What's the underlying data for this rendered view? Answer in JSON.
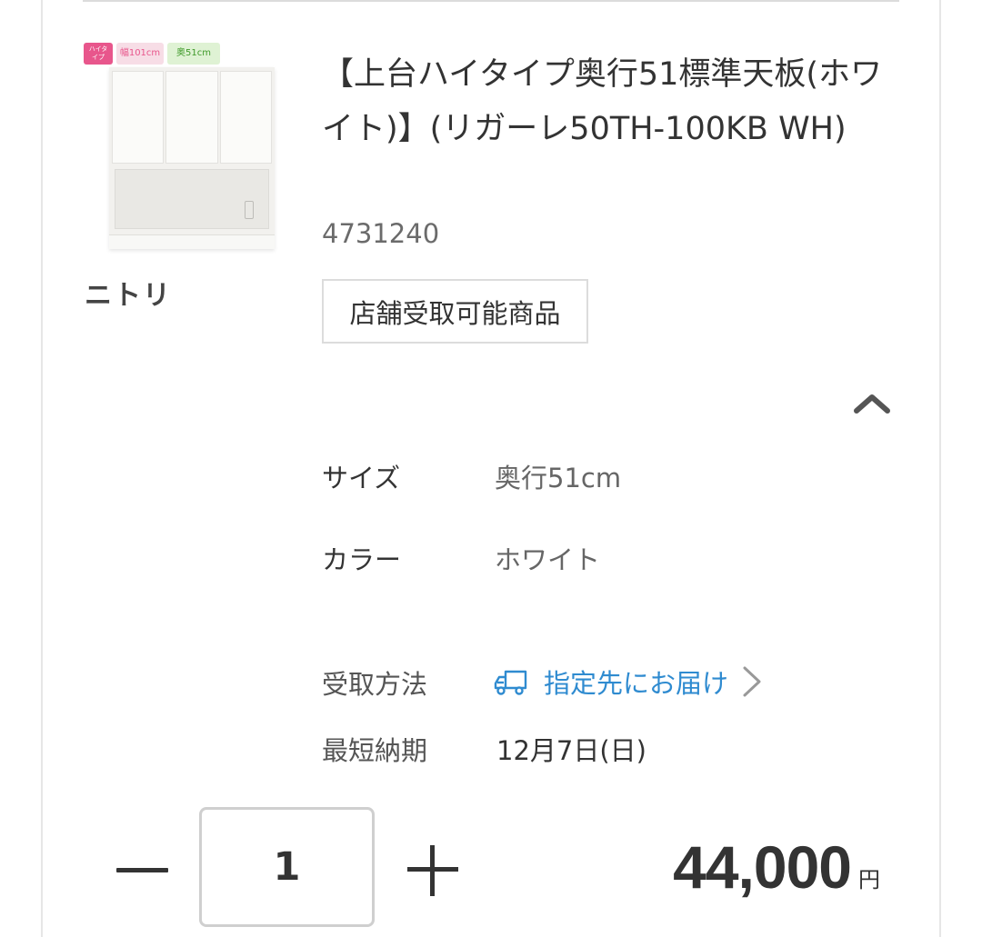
{
  "product": {
    "title": "【上台ハイタイプ奥行51標準天板(ホワイト)】(リガーレ50TH-100KB WH)",
    "code": "4731240",
    "maker": "ニトリ",
    "store_tag": "店舗受取可能商品",
    "image": {
      "badge_type": "ハイタイプ",
      "badge_width": "幅101cm",
      "badge_depth": "奥51cm"
    }
  },
  "options": {
    "collapse_icon": "chevron-up-icon",
    "size_label": "サイズ",
    "size_value": "奥行51cm",
    "color_label": "カラー",
    "color_value": "ホワイト"
  },
  "delivery": {
    "method_label": "受取方法",
    "method_value": "指定先にお届け",
    "method_icon": "truck-icon",
    "date_label": "最短納期",
    "date_value": "12月7日(日)"
  },
  "purchase": {
    "quantity": "1",
    "price": "44,000",
    "currency": "円"
  },
  "colors": {
    "link": "#2f8bd0",
    "text": "#333333",
    "border": "#dcdcdc"
  }
}
